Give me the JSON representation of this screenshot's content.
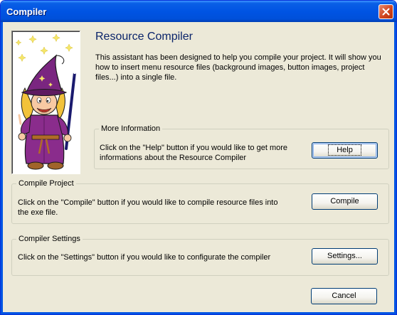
{
  "window": {
    "title": "Compiler"
  },
  "header": {
    "title": "Resource Compiler",
    "description": "This assistant has been designed to help you compile your project. It will show you how to insert menu resource files (background images, button images, project files...) into a single file."
  },
  "more_info": {
    "legend": "More Information",
    "text": "Click on the \"Help\" button if you would like to get more informations about the Resource Compiler",
    "button": "Help"
  },
  "compile_project": {
    "legend": "Compile Project",
    "text": "Click on the \"Compile\" button if you would like to compile resource files into the exe file.",
    "button": "Compile"
  },
  "compiler_settings": {
    "legend": "Compiler Settings",
    "text": "Click on the \"Settings\" button if you would like to configurate the compiler",
    "button": "Settings..."
  },
  "footer": {
    "cancel": "Cancel"
  },
  "icons": {
    "close": "close-icon",
    "illustration": "wizard-illustration"
  }
}
